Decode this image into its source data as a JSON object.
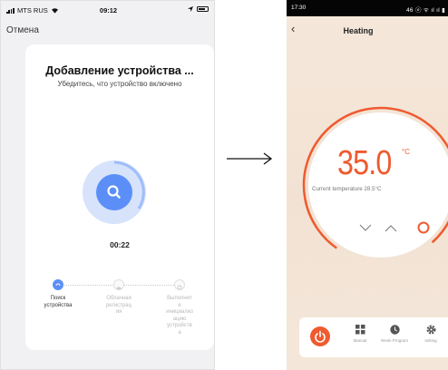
{
  "left": {
    "status": {
      "carrier": "MTS RUS",
      "time": "09:12"
    },
    "cancel_label": "Отмена",
    "title": "Добавление устройства ...",
    "subtitle": "Убедитесь, что устройство включено",
    "timer": "00:22",
    "steps": [
      {
        "label": "Поиск\nустройства",
        "state": "active"
      },
      {
        "label": "Облачная\nрегистрац\nия",
        "state": "pending"
      },
      {
        "label": "Выполнит\nе\nинициализ\nацию\nустройств\nа",
        "state": "pending"
      }
    ]
  },
  "right": {
    "status": {
      "time": "17:30",
      "icons_text": "46 ⓔ ᯤ ıl ıl ▮"
    },
    "title": "Heating",
    "temperature": "35.0",
    "unit": "°C",
    "current_temp_text": "Current temperature 28.5°C",
    "nav": {
      "manual": "Manual",
      "week_program": "Week Program",
      "setting": "setting"
    }
  },
  "colors": {
    "accent_blue": "#5b8ff7",
    "accent_orange": "#ef5a2f",
    "halo_blue": "#d6e3fb"
  }
}
